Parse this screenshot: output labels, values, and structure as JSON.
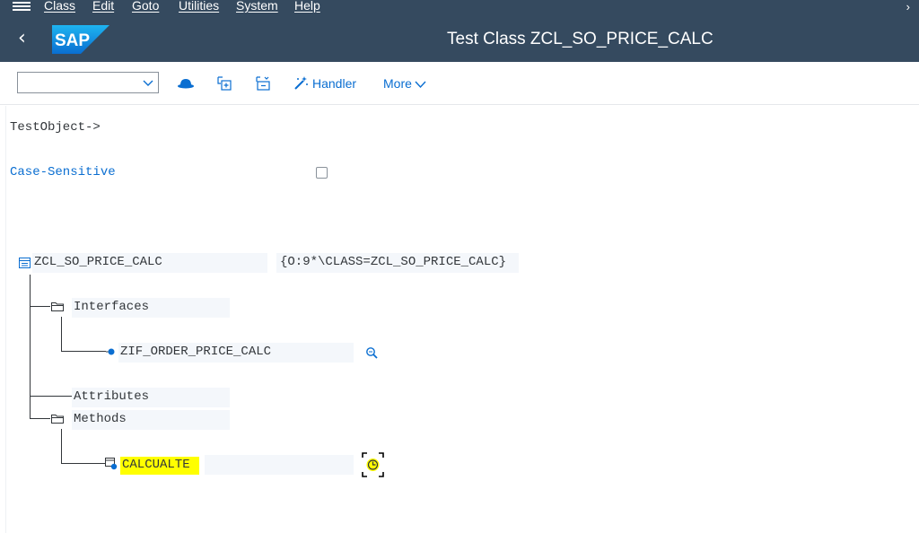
{
  "menubar": {
    "items": [
      "Class",
      "Edit",
      "Goto",
      "Utilities",
      "System",
      "Help"
    ]
  },
  "titlebar": {
    "title": "Test Class ZCL_SO_PRICE_CALC",
    "logo_text": "SAP"
  },
  "toolbar": {
    "combo_value": "",
    "handler_label": "Handler",
    "more_label": "More",
    "icons": [
      "hat-icon",
      "expand-subtree-icon",
      "collapse-subtree-icon",
      "magic-wand-icon"
    ]
  },
  "content": {
    "test_object_label": "TestObject->",
    "case_sensitive_label": "Case-Sensitive",
    "case_sensitive_checked": false,
    "tree": {
      "root": {
        "label": "ZCL_SO_PRICE_CALC",
        "ref": "{O:9*\\CLASS=ZCL_SO_PRICE_CALC}"
      },
      "interfaces": {
        "label": "Interfaces",
        "children": [
          {
            "label": "ZIF_ORDER_PRICE_CALC"
          }
        ]
      },
      "attributes": {
        "label": "Attributes"
      },
      "methods": {
        "label": "Methods",
        "children": [
          {
            "label": "CALCUALTE"
          }
        ]
      }
    }
  },
  "colors": {
    "shell": "#354a5f",
    "accent": "#0a6ed1",
    "highlight": "#ffff00",
    "text": "#32363a"
  }
}
